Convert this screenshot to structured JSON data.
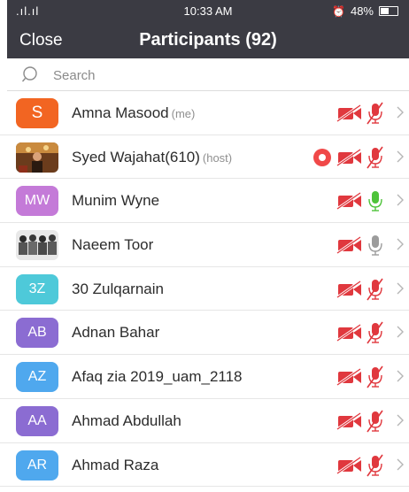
{
  "status_bar": {
    "signal": ".ıl.ıl",
    "time": "10:33 AM",
    "battery": "48%"
  },
  "nav": {
    "close_label": "Close",
    "title": "Participants (92)"
  },
  "search": {
    "placeholder": "Search"
  },
  "colors": {
    "header_bg": "#3b3b43",
    "muted_red": "#e0383e",
    "active_green": "#4ec33a",
    "neutral_gray": "#9c9c9c"
  },
  "participants": [
    {
      "initials": "S",
      "avatar_color": "#f26522",
      "name": "Amna Masood",
      "tag": "(me)",
      "video": "off",
      "mic": "muted",
      "recording": false
    },
    {
      "initials": "",
      "avatar_color": "#8a5a2b",
      "name": "Syed Wajahat(610)",
      "tag": "(host)",
      "video": "off",
      "mic": "muted",
      "recording": true,
      "photo": true
    },
    {
      "initials": "MW",
      "avatar_color": "#c47ad8",
      "name": "Munim Wyne",
      "tag": "",
      "video": "off",
      "mic": "active",
      "recording": false
    },
    {
      "initials": "",
      "avatar_color": "#6d6d6d",
      "name": "Naeem Toor",
      "tag": "",
      "video": "off",
      "mic": "on",
      "recording": false,
      "photo": true
    },
    {
      "initials": "3Z",
      "avatar_color": "#4ec9d9",
      "name": "30 Zulqarnain",
      "tag": "",
      "video": "off",
      "mic": "muted",
      "recording": false
    },
    {
      "initials": "AB",
      "avatar_color": "#8b6cd2",
      "name": "Adnan Bahar",
      "tag": "",
      "video": "off",
      "mic": "muted",
      "recording": false
    },
    {
      "initials": "AZ",
      "avatar_color": "#4fa8ee",
      "name": "Afaq zia 2019_uam_2118",
      "tag": "",
      "video": "off",
      "mic": "muted",
      "recording": false
    },
    {
      "initials": "AA",
      "avatar_color": "#8b6cd2",
      "name": "Ahmad Abdullah",
      "tag": "",
      "video": "off",
      "mic": "muted",
      "recording": false
    },
    {
      "initials": "AR",
      "avatar_color": "#4fa8ee",
      "name": "Ahmad Raza",
      "tag": "",
      "video": "off",
      "mic": "muted",
      "recording": false
    }
  ]
}
